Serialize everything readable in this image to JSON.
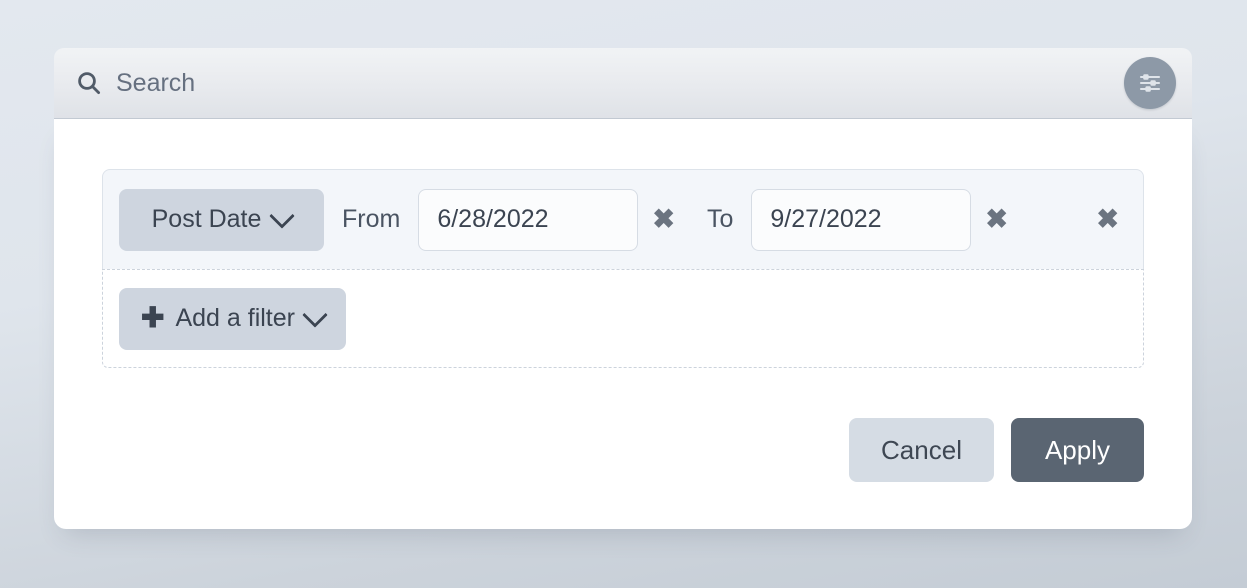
{
  "search": {
    "placeholder": "Search",
    "value": "",
    "icon": "search-icon",
    "filter_toggle_icon": "sliders-icon"
  },
  "filter_panel": {
    "rows": [
      {
        "field_label": "Post Date",
        "field_chevron_icon": "chevron-down-icon",
        "from_label": "From",
        "from_value": "6/28/2022",
        "from_clear_icon": "clear-x-icon",
        "to_label": "To",
        "to_value": "9/27/2022",
        "to_clear_icon": "clear-x-icon",
        "row_remove_icon": "clear-x-icon",
        "clear_glyph": "✖"
      }
    ],
    "add_filter": {
      "plus_glyph": "✚",
      "label": "Add a filter",
      "chevron_icon": "chevron-down-icon"
    }
  },
  "actions": {
    "cancel_label": "Cancel",
    "apply_label": "Apply"
  },
  "colors": {
    "page_background": "#dfe5ec",
    "panel_background": "#ffffff",
    "search_bar_background": "#e8eaee",
    "filter_row_background": "#f3f6fa",
    "pill_background": "#ced5df",
    "apply_background": "#5a6572",
    "cancel_background": "#d5dce4",
    "text_primary": "#3b4451",
    "text_muted": "#667080",
    "filter_toggle_background": "#8d99a7"
  }
}
